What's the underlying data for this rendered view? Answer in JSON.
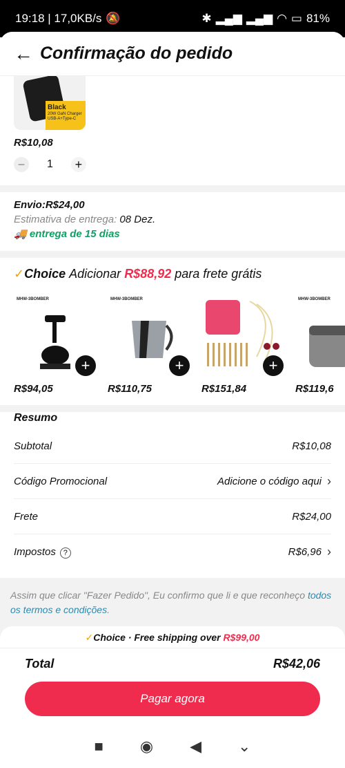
{
  "status": {
    "time_speed": "19:18 | 17,0KB/s",
    "battery": "81%"
  },
  "header": {
    "title": "Confirmação do pedido"
  },
  "product": {
    "image_label_main": "Black",
    "image_label_sub": "20W GaN Charger",
    "image_label_sub2": "USB-A+Type-C",
    "price": "R$10,08",
    "quantity": "1"
  },
  "shipping": {
    "label": "Envio:R$24,00",
    "estimate_label": "Estimativa de entrega:",
    "estimate_date": "08 Dez.",
    "delivery_days": "entrega de 15 dias"
  },
  "choice": {
    "prefix": "Choice",
    "text1": "Adicionar",
    "amount": "R$88,92",
    "text2": "para frete grátis",
    "items": [
      {
        "brand": "MHW-3BOMBER",
        "price": "R$94,05"
      },
      {
        "brand": "MHW-3BOMBER",
        "price": "R$110,75"
      },
      {
        "brand": "",
        "price": "R$151,84"
      },
      {
        "brand": "MHW-3BOMBER",
        "price": "R$119,6"
      }
    ]
  },
  "summary": {
    "title": "Resumo",
    "subtotal_label": "Subtotal",
    "subtotal_value": "R$10,08",
    "promo_label": "Código Promocional",
    "promo_value": "Adicione o código aqui",
    "shipping_label": "Frete",
    "shipping_value": "R$24,00",
    "taxes_label": "Impostos",
    "taxes_value": "R$6,96"
  },
  "terms": {
    "text": "Assim que clicar \"Fazer Pedido\", Eu confirmo que li e que reconheço",
    "link": "todos os termos e condições",
    "end": "."
  },
  "bottom": {
    "banner_choice": "Choice",
    "banner_text": "· Free shipping over",
    "banner_amount": "R$99,00",
    "total_label": "Total",
    "total_value": "R$42,06",
    "pay_label": "Pagar agora"
  },
  "colors": {
    "accent_red": "#ef2c4d",
    "green": "#0fa065",
    "choice_gold": "#f5a300",
    "link": "#2a8ab0"
  }
}
